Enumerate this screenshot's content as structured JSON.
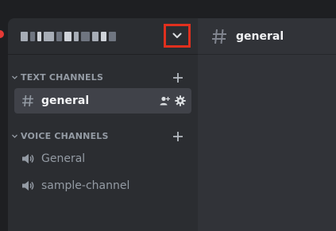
{
  "colors": {
    "sidebar_bg": "#2b2d31",
    "main_bg": "#313338",
    "active_channel_bg": "#404249",
    "muted_text": "#949ba4",
    "bright_text": "#f2f3f5",
    "highlight_box": "#e0301e"
  },
  "server": {
    "name_pixelated": "redacted server name",
    "dropdown_icon": "chevron-down-icon"
  },
  "categories": [
    {
      "label": "TEXT CHANNELS",
      "channels": [
        {
          "name": "general",
          "type": "text",
          "active": true,
          "icon": "hash-icon"
        }
      ]
    },
    {
      "label": "VOICE CHANNELS",
      "channels": [
        {
          "name": "General",
          "type": "voice",
          "active": false,
          "icon": "speaker-icon"
        },
        {
          "name": "sample-channel",
          "type": "voice",
          "active": false,
          "icon": "speaker-icon"
        }
      ]
    }
  ],
  "main": {
    "channel_title": "general",
    "title_icon": "hash-icon"
  }
}
